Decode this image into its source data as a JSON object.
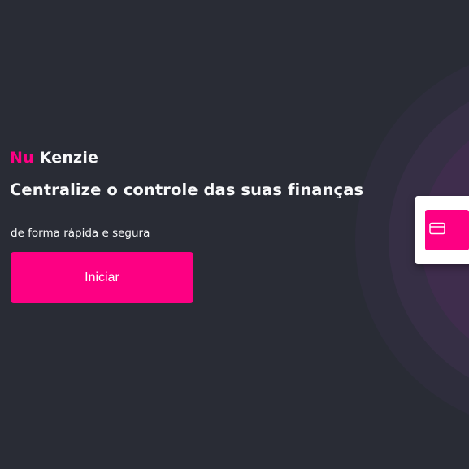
{
  "brand": {
    "part1": "Nu",
    "part2": "Kenzie"
  },
  "hero": {
    "headline": "Centralize o controle das suas finanças",
    "subtitle": "de forma rápida e segura",
    "cta_label": "Iniciar"
  },
  "decoration": {
    "card_icon": "credit-card-icon"
  },
  "colors": {
    "background": "#292c35",
    "accent": "#fd0083",
    "text": "#f8f9fa",
    "card": "#ffffff"
  }
}
